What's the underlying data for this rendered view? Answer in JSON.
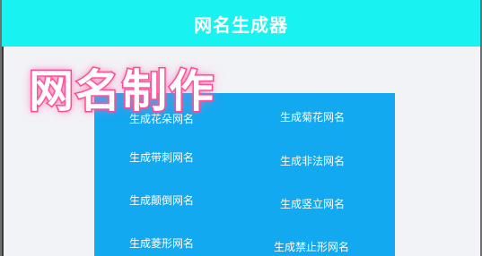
{
  "header": {
    "title": "网名生成器"
  },
  "overlay_title": "网名制作",
  "options": [
    {
      "label": "生成花朵网名"
    },
    {
      "label": "生成菊花网名"
    },
    {
      "label": "生成带刺网名"
    },
    {
      "label": "生成非法网名"
    },
    {
      "label": "生成颠倒网名"
    },
    {
      "label": "生成竖立网名"
    },
    {
      "label": "生成菱形网名"
    },
    {
      "label": "生成禁止形网名"
    }
  ],
  "colors": {
    "header_bg": "#18f3f1",
    "panel_bg": "#12a9f1",
    "page_bg": "#f2f3f7",
    "overlay_stroke": "#ff3d84"
  }
}
